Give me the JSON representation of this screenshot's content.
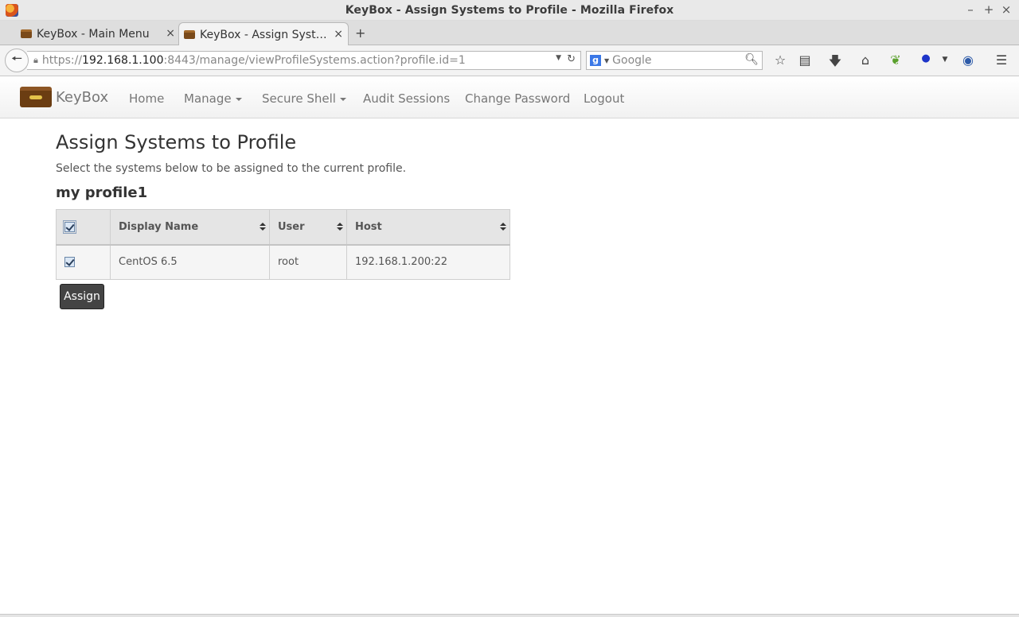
{
  "window": {
    "title": "KeyBox - Assign Systems to Profile - Mozilla Firefox",
    "minimize": "–",
    "maximize": "+",
    "close": "×"
  },
  "tabs": [
    {
      "label": "KeyBox - Main Menu",
      "active": false
    },
    {
      "label": "KeyBox - Assign Syst…",
      "active": true
    }
  ],
  "tab_close": "×",
  "new_tab": "+",
  "address": {
    "scheme": "https://",
    "host": "192.168.1.100",
    "rest": ":8443/manage/viewProfileSystems.action?profile.id=1"
  },
  "search": {
    "engine_letter": "g",
    "placeholder": "Google"
  },
  "icons": {
    "back": "back-arrow-icon",
    "lock": "lock-icon",
    "reload": "reload-icon",
    "search": "magnifier-icon",
    "bookmark": "star-icon",
    "reader": "reading-list-icon",
    "download": "download-icon",
    "home": "home-icon",
    "leaf": "leaf-icon",
    "abe": "abp-icon",
    "pocket": "circle-icon",
    "menu": "hamburger-icon"
  },
  "app": {
    "brand": "KeyBox",
    "nav": [
      "Home",
      "Manage",
      "Secure Shell",
      "Audit Sessions",
      "Change Password",
      "Logout"
    ]
  },
  "page": {
    "title": "Assign Systems to Profile",
    "description": "Select the systems below to be assigned to the current profile.",
    "profile_name": "my profile1",
    "table": {
      "headers": [
        "Display Name",
        "User",
        "Host"
      ],
      "rows": [
        {
          "checked": true,
          "display_name": "CentOS 6.5",
          "user": "root",
          "host": "192.168.1.200:22"
        }
      ]
    },
    "assign_label": "Assign"
  }
}
